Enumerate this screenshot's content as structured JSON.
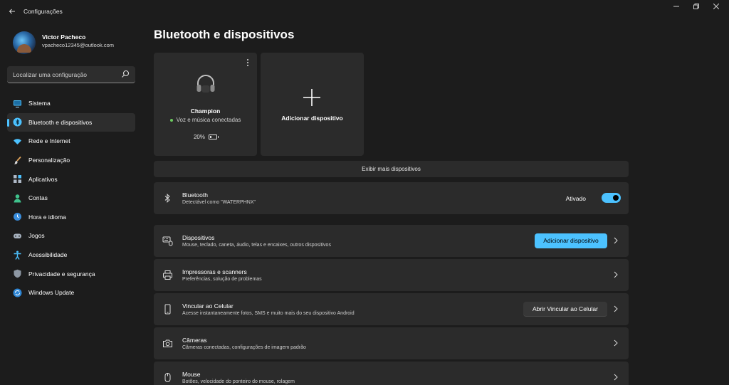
{
  "window": {
    "title": "Configurações",
    "back_icon": "arrow-left-icon"
  },
  "user": {
    "name": "Victor Pacheco",
    "email": "vpacheco12345@outlook.com"
  },
  "search": {
    "placeholder": "Localizar uma configuração"
  },
  "sidebar": {
    "items": [
      {
        "label": "Sistema",
        "icon": "monitor-icon"
      },
      {
        "label": "Bluetooth e dispositivos",
        "icon": "bluetooth-icon",
        "active": true
      },
      {
        "label": "Rede e Internet",
        "icon": "wifi-icon"
      },
      {
        "label": "Personalização",
        "icon": "brush-icon"
      },
      {
        "label": "Aplicativos",
        "icon": "apps-icon"
      },
      {
        "label": "Contas",
        "icon": "person-icon"
      },
      {
        "label": "Hora e idioma",
        "icon": "globe-clock-icon"
      },
      {
        "label": "Jogos",
        "icon": "gamepad-icon"
      },
      {
        "label": "Acessibilidade",
        "icon": "accessibility-icon"
      },
      {
        "label": "Privacidade e segurança",
        "icon": "shield-icon"
      },
      {
        "label": "Windows Update",
        "icon": "update-icon"
      }
    ]
  },
  "main": {
    "title": "Bluetooth e dispositivos",
    "device_card": {
      "name": "Champion",
      "status": "Voz e música conectadas",
      "battery": "20%",
      "battery_level": 0.2
    },
    "add_card": {
      "label": "Adicionar dispositivo"
    },
    "more_devices": "Exibir mais dispositivos",
    "rows": {
      "bluetooth": {
        "title": "Bluetooth",
        "subtitle": "Detectável como \"WATERPHNX\"",
        "toggle_label": "Ativado",
        "toggle_on": true
      },
      "devices": {
        "title": "Dispositivos",
        "subtitle": "Mouse, teclado, caneta, áudio, telas e encaixes, outros dispositivos",
        "button": "Adicionar dispositivo"
      },
      "printers": {
        "title": "Impressoras e scanners",
        "subtitle": "Preferências, solução de problemas"
      },
      "phone": {
        "title": "Vincular ao Celular",
        "subtitle": "Acesse instantaneamente fotos, SMS e muito mais do seu dispositivo Android",
        "button": "Abrir Vincular ao Celular"
      },
      "cameras": {
        "title": "Câmeras",
        "subtitle": "Câmeras conectadas, configurações de imagem padrão"
      },
      "mouse": {
        "title": "Mouse",
        "subtitle": "Botões, velocidade do ponteiro do mouse, rolagem"
      }
    }
  },
  "colors": {
    "accent": "#4cc2ff",
    "background": "#1c1c1c",
    "card": "#2b2b2b",
    "status_dot": "#6ccb5f"
  }
}
